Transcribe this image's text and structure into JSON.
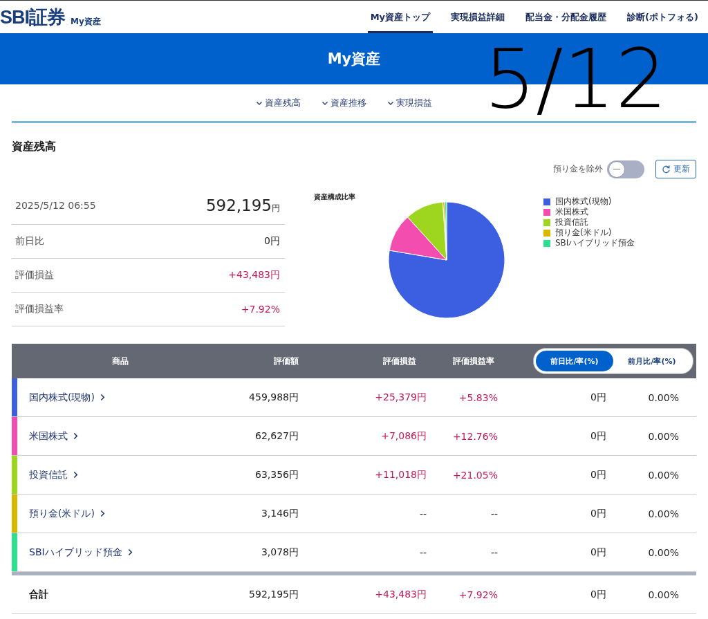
{
  "header": {
    "logo": "SBI証券",
    "subtitle": "My資産",
    "nav": [
      {
        "label": "My資産トップ",
        "selected": true
      },
      {
        "label": "実現損益詳細",
        "selected": false
      },
      {
        "label": "配当金・分配金履歴",
        "selected": false
      },
      {
        "label": "診断(ポトフォる)",
        "selected": false
      }
    ]
  },
  "banner": {
    "title": "My資産"
  },
  "subnav": [
    "資産残高",
    "資産推移",
    "実現損益"
  ],
  "annotation": "5/12",
  "section": {
    "title": "資産残高",
    "toggle": {
      "label": "預り金を除外",
      "on": false
    },
    "refresh": "更新",
    "summary": [
      {
        "label": "2025/5/12 06:55",
        "value": "592,195",
        "unit": "円",
        "kind": "total"
      },
      {
        "label": "前日比",
        "value": "0円",
        "kind": "row",
        "positive": false
      },
      {
        "label": "評価損益",
        "value": "+43,483円",
        "kind": "row",
        "positive": true
      },
      {
        "label": "評価損益率",
        "value": "+7.92%",
        "kind": "row",
        "positive": true
      }
    ],
    "chart_data": {
      "type": "pie",
      "title": "資産構成比率",
      "categories": [
        "国内株式(現物)",
        "米国株式",
        "投資信託",
        "預り金(米ドル)",
        "SBIハイブリッド預金"
      ],
      "values": [
        77.67,
        10.58,
        10.7,
        0.53,
        0.52
      ],
      "colors": [
        "#3b5fe0",
        "#f44db0",
        "#9ed61f",
        "#d9b800",
        "#2fe090"
      ],
      "legend": "right"
    }
  },
  "table": {
    "columns": [
      "商品",
      "評価額",
      "評価損益",
      "評価損益率"
    ],
    "periods": [
      {
        "label": "前日比/率(%)",
        "selected": true
      },
      {
        "label": "前月比/率(%)",
        "selected": false
      }
    ],
    "rows": [
      {
        "name": "国内株式(現物)",
        "color": "#3b5fe0",
        "value": "459,988円",
        "gain": "+25,379円",
        "rate": "+5.83%",
        "positive": true,
        "change": "0円",
        "change_rate": "0.00%"
      },
      {
        "name": "米国株式",
        "color": "#f44db0",
        "value": "62,627円",
        "gain": "+7,086円",
        "rate": "+12.76%",
        "positive": true,
        "change": "0円",
        "change_rate": "0.00%"
      },
      {
        "name": "投資信託",
        "color": "#9ed61f",
        "value": "63,356円",
        "gain": "+11,018円",
        "rate": "+21.05%",
        "positive": true,
        "change": "0円",
        "change_rate": "0.00%"
      },
      {
        "name": "預り金(米ドル)",
        "color": "#d9b800",
        "value": "3,146円",
        "gain": "--",
        "rate": "--",
        "positive": false,
        "change": "0円",
        "change_rate": "0.00%"
      },
      {
        "name": "SBIハイブリッド預金",
        "color": "#2fe090",
        "value": "3,078円",
        "gain": "--",
        "rate": "--",
        "positive": false,
        "change": "0円",
        "change_rate": "0.00%"
      }
    ],
    "total": {
      "label": "合計",
      "value": "592,195円",
      "gain": "+43,483円",
      "rate": "+7.92%",
      "positive": true,
      "change": "0円",
      "change_rate": "0.00%"
    }
  }
}
